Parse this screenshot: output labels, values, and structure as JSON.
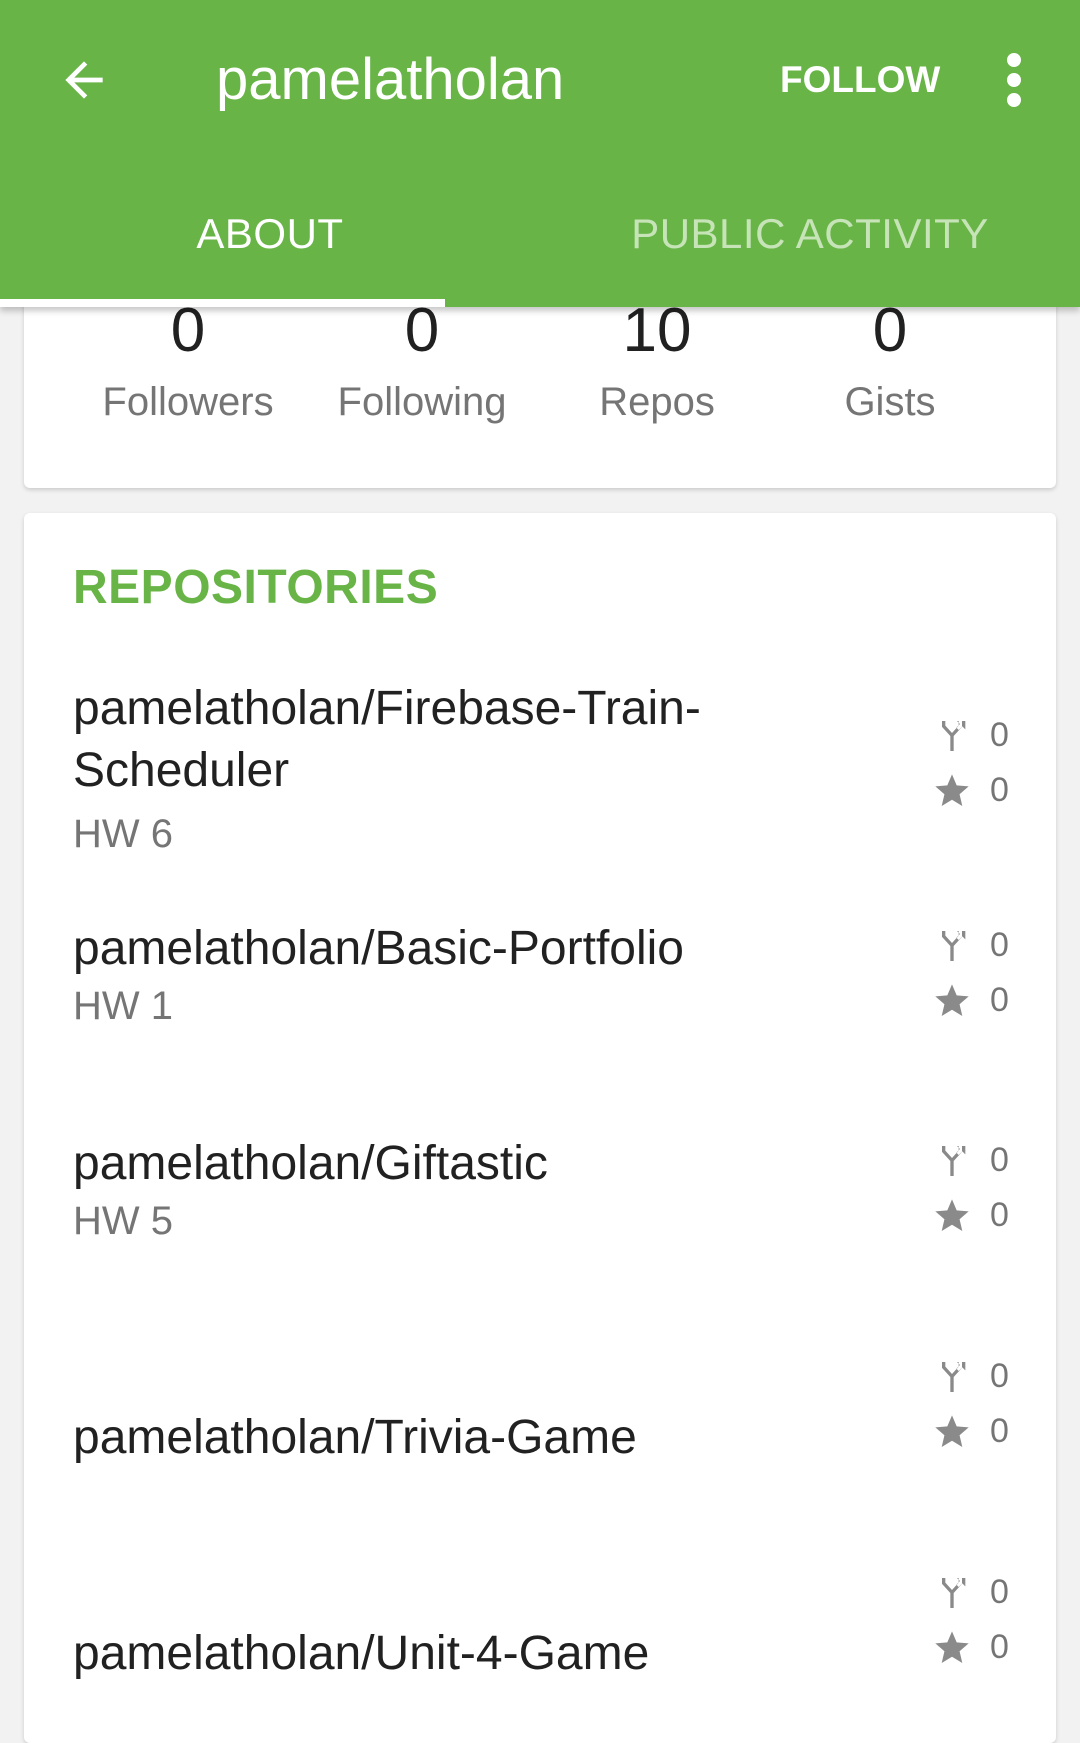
{
  "appbar": {
    "title": "pamelatholan",
    "follow_label": "FOLLOW",
    "tabs": [
      {
        "label": "ABOUT",
        "active": true
      },
      {
        "label": "PUBLIC ACTIVITY",
        "active": false
      }
    ],
    "color": "#68b446"
  },
  "stats": [
    {
      "value": "0",
      "label": "Followers"
    },
    {
      "value": "0",
      "label": "Following"
    },
    {
      "value": "10",
      "label": "Repos"
    },
    {
      "value": "0",
      "label": "Gists"
    }
  ],
  "repositories": {
    "title": "REPOSITORIES",
    "items": [
      {
        "name": "pamelatholan/Firebase-Train-Scheduler",
        "description": "HW 6",
        "forks": "0",
        "stars": "0"
      },
      {
        "name": "pamelatholan/Basic-Portfolio",
        "description": "HW 1",
        "forks": "0",
        "stars": "0"
      },
      {
        "name": "pamelatholan/Giftastic",
        "description": "HW 5",
        "forks": "0",
        "stars": "0"
      },
      {
        "name": "pamelatholan/Trivia-Game",
        "description": "",
        "forks": "0",
        "stars": "0"
      },
      {
        "name": "pamelatholan/Unit-4-Game",
        "description": "",
        "forks": "0",
        "stars": "0"
      }
    ]
  },
  "icons": {
    "back": "arrow-back-icon",
    "more": "more-vert-icon",
    "fork": "fork-icon",
    "star": "star-icon"
  }
}
